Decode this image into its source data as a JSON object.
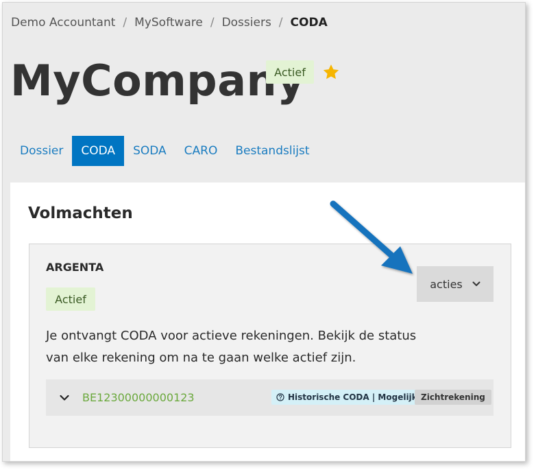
{
  "breadcrumb": {
    "items": [
      "Demo Accountant",
      "MySoftware",
      "Dossiers"
    ],
    "current": "CODA",
    "separator": "/"
  },
  "header": {
    "title": "MyCompany",
    "status_badge": "Actief",
    "favorite_icon": "star-icon",
    "star_color": "#f6b500"
  },
  "tabs": [
    {
      "label": "Dossier",
      "active": false
    },
    {
      "label": "CODA",
      "active": true
    },
    {
      "label": "SODA",
      "active": false
    },
    {
      "label": "CARO",
      "active": false
    },
    {
      "label": "Bestandslijst",
      "active": false
    }
  ],
  "section": {
    "title": "Volmachten",
    "card": {
      "bank_name": "ARGENTA",
      "status_badge": "Actief",
      "actions_label": "acties",
      "description_line1": "Je ontvangt CODA voor actieve rekeningen. Bekijk de status",
      "description_line2": "van elke rekening om na te gaan welke actief zijn.",
      "account": {
        "iban": "BE12300000000123",
        "history_badge": "Historische CODA | Mogelijk",
        "type_badge": "Zichtrekening"
      }
    }
  },
  "colors": {
    "accent": "#0075c2",
    "active_badge_bg": "#e3f3d4",
    "iban_link": "#6aa83c",
    "arrow": "#1673bd"
  }
}
